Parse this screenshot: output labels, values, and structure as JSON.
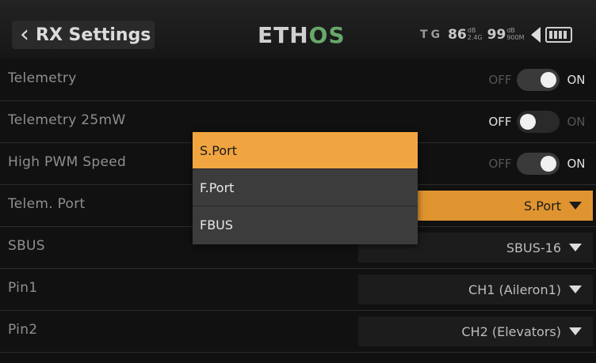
{
  "header": {
    "title": "RX Settings",
    "logo_main": "ETH",
    "logo_accent": "OS",
    "status": {
      "t_label": "T",
      "g_label": "G",
      "rssi1_value": "86",
      "rssi1_unit": "dB",
      "rssi1_band": "2.4G",
      "rssi2_value": "99",
      "rssi2_unit": "dB",
      "rssi2_band": "900M"
    }
  },
  "rows": [
    {
      "label": "Telemetry",
      "type": "toggle",
      "off_label": "OFF",
      "on_label": "ON",
      "value": "ON"
    },
    {
      "label": "Telemetry 25mW",
      "type": "toggle",
      "off_label": "OFF",
      "on_label": "ON",
      "value": "OFF"
    },
    {
      "label": "High PWM Speed",
      "type": "toggle",
      "off_label": "OFF",
      "on_label": "ON",
      "value": "ON"
    },
    {
      "label": "Telem. Port",
      "type": "select",
      "value": "S.Port",
      "active": true
    },
    {
      "label": "SBUS",
      "type": "select",
      "value": "SBUS-16"
    },
    {
      "label": "Pin1",
      "type": "select",
      "value": "CH1 (Aileron1)"
    },
    {
      "label": "Pin2",
      "type": "select",
      "value": "CH2 (Elevators)"
    }
  ],
  "popup": {
    "options": [
      "S.Port",
      "F.Port",
      "FBUS"
    ],
    "selected_index": 0
  },
  "colors": {
    "accent": "#e0942f",
    "popup_selected": "#f1a540",
    "logo_accent": "#67a86b"
  }
}
